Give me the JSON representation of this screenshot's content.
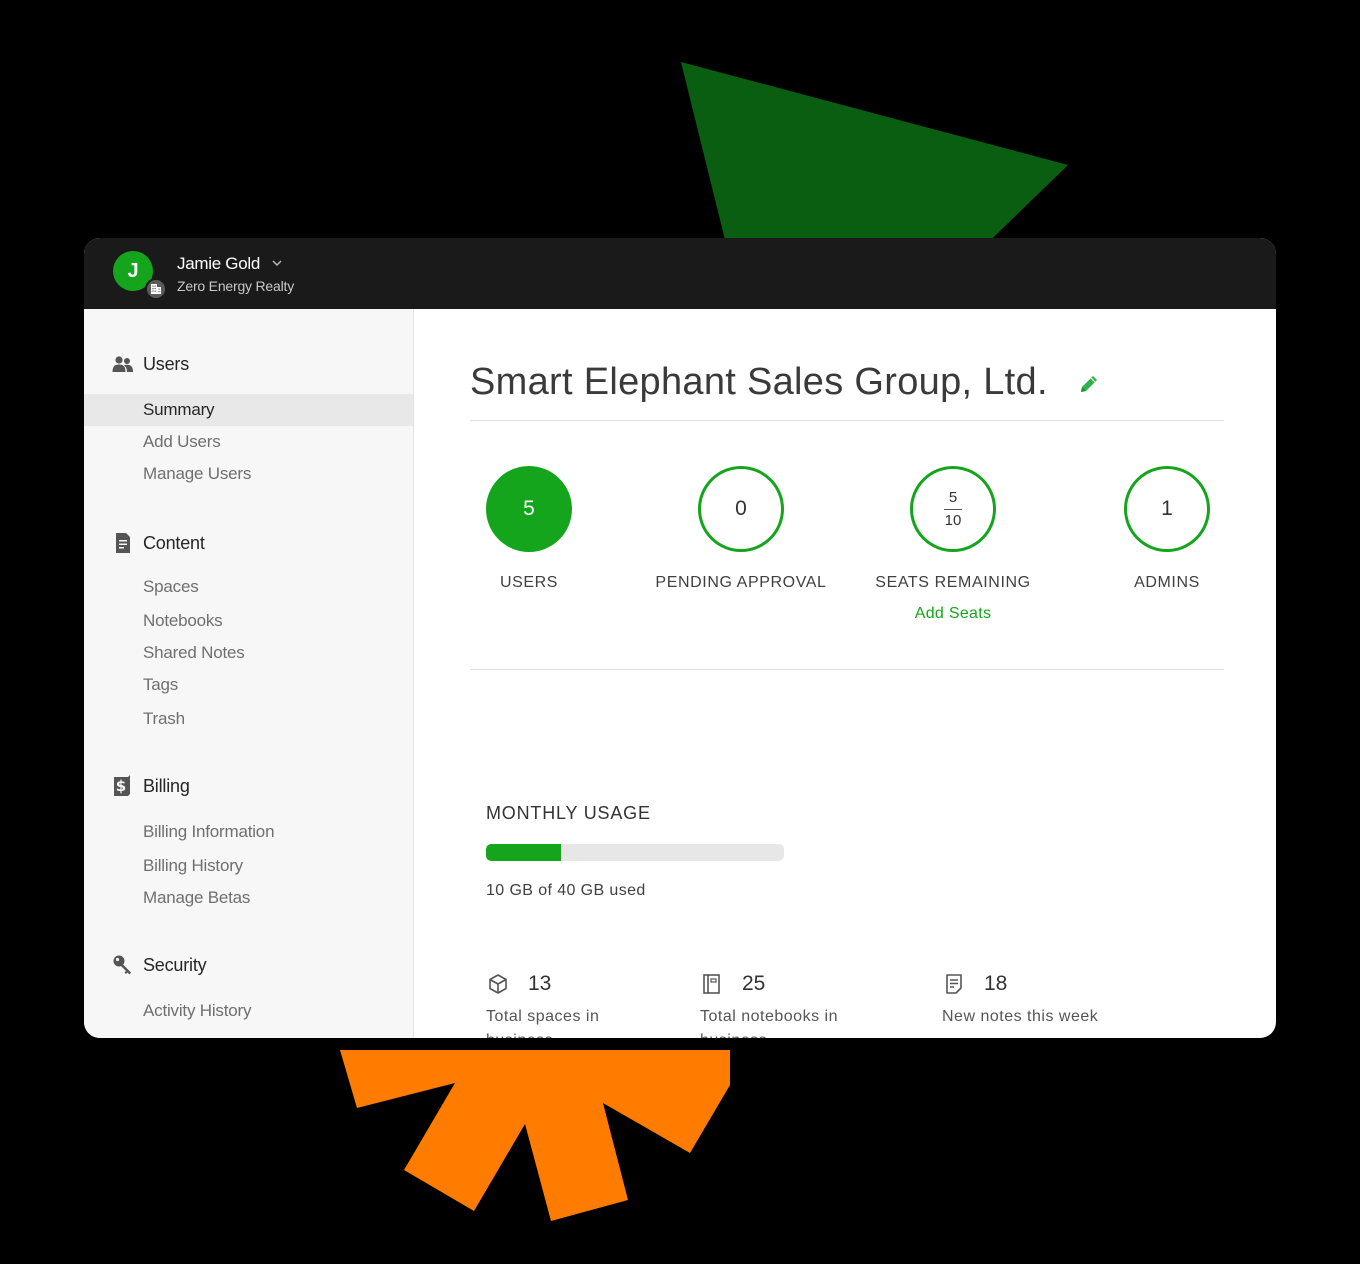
{
  "header": {
    "avatar_initial": "J",
    "user_name": "Jamie Gold",
    "org_name": "Zero Energy Realty"
  },
  "sidebar": {
    "sections": [
      {
        "label": "Users",
        "icon": "users-icon",
        "items": [
          "Summary",
          "Add Users",
          "Manage Users"
        ]
      },
      {
        "label": "Content",
        "icon": "document-icon",
        "items": [
          "Spaces",
          "Notebooks",
          "Shared Notes",
          "Tags",
          "Trash"
        ]
      },
      {
        "label": "Billing",
        "icon": "dollar-icon",
        "items": [
          "Billing Information",
          "Billing History",
          "Manage Betas"
        ]
      },
      {
        "label": "Security",
        "icon": "key-icon",
        "items": [
          "Activity History"
        ]
      }
    ],
    "active_item": "Summary"
  },
  "main": {
    "title": "Smart Elephant Sales Group, Ltd.",
    "stats": {
      "users": {
        "value": "5",
        "label": "USERS"
      },
      "pending": {
        "value": "0",
        "label": "PENDING APPROVAL"
      },
      "seats": {
        "numerator": "5",
        "denominator": "10",
        "label": "SEATS REMAINING",
        "link": "Add Seats"
      },
      "admins": {
        "value": "1",
        "label": "ADMINS"
      }
    },
    "usage": {
      "title": "MONTHLY USAGE",
      "used_fraction": 0.25,
      "text": "10 GB of 40 GB used"
    },
    "metrics": {
      "spaces": {
        "value": "13",
        "desc": "Total spaces in business",
        "icon": "cube-icon"
      },
      "notebooks": {
        "value": "25",
        "desc": "Total notebooks in business",
        "icon": "notebook-icon"
      },
      "notes": {
        "value": "18",
        "desc": "New notes this week",
        "icon": "note-icon"
      }
    }
  },
  "colors": {
    "accent": "#14a51c",
    "decor_green": "#0a5e12",
    "decor_orange": "#ff7c00",
    "topbar": "#1a1a1a"
  }
}
